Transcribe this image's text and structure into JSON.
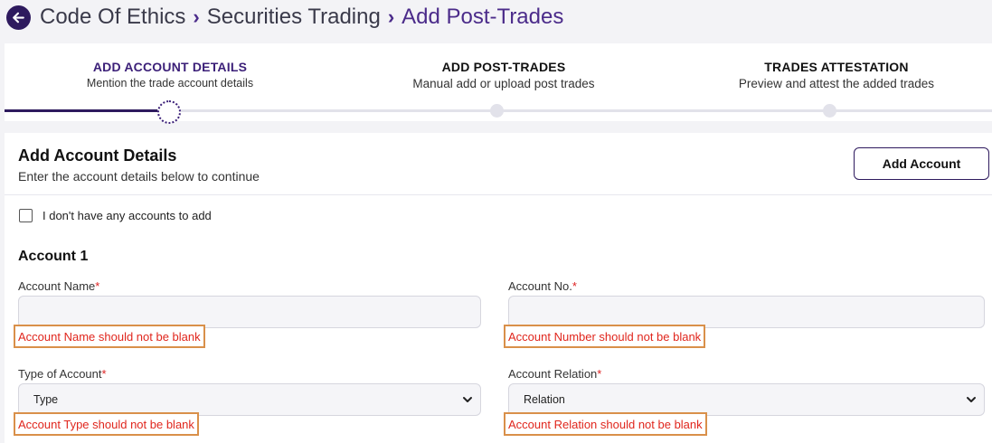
{
  "breadcrumb": {
    "items": [
      "Code Of Ethics",
      "Securities Trading",
      "Add Post-Trades"
    ]
  },
  "stepper": {
    "steps": [
      {
        "title": "ADD ACCOUNT DETAILS",
        "subtitle": "Mention the trade account details"
      },
      {
        "title": "ADD POST-TRADES",
        "subtitle": "Manual add or upload post trades"
      },
      {
        "title": "TRADES ATTESTATION",
        "subtitle": "Preview and attest the added trades"
      }
    ]
  },
  "card": {
    "title": "Add Account Details",
    "subtitle": "Enter the account details below to continue",
    "add_account_label": "Add Account",
    "no_accounts_label": "I don't have any accounts to add",
    "account_heading": "Account 1"
  },
  "form": {
    "account_name": {
      "label": "Account Name",
      "required": "*",
      "error": "Account Name should not be blank"
    },
    "account_no": {
      "label": "Account No.",
      "required": "*",
      "error": "Account Number should not be blank"
    },
    "account_type": {
      "label": "Type of Account",
      "required": "*",
      "value": "Type",
      "error": "Account Type should not be blank"
    },
    "account_relation": {
      "label": "Account Relation",
      "required": "*",
      "value": "Relation",
      "error": "Account Relation should not be blank"
    }
  },
  "colors": {
    "brand": "#2e1a5e",
    "error": "#e0261d",
    "highlight": "#d9904a"
  },
  "icons": {
    "back": "arrow-left-icon",
    "breadcrumb_separator": "chevron-right-icon",
    "select": "chevron-down-icon"
  }
}
